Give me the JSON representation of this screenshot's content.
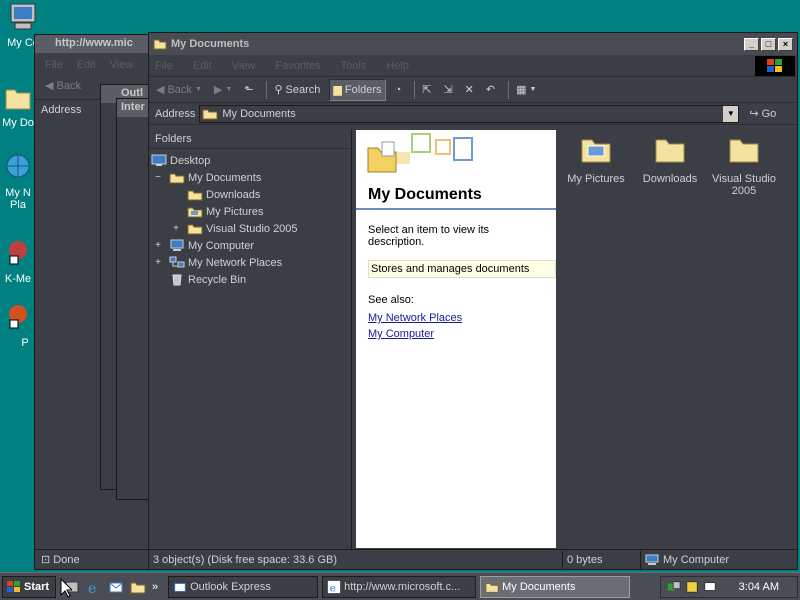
{
  "desktop": {
    "icons": [
      {
        "label": "My Co"
      },
      {
        "label": "My Do"
      },
      {
        "label": "My N Pla"
      },
      {
        "label": "K-Me"
      },
      {
        "label": "P"
      }
    ]
  },
  "bg_windows": {
    "ie_title": "http://www.mic",
    "ie_menu": [
      "File",
      "Edit",
      "View"
    ],
    "ie_back": "Back",
    "ie_address": "Address",
    "ie_status": "Done",
    "outlook_title": "Outl",
    "inter_title": "Inter"
  },
  "window": {
    "title": "My Documents",
    "menu": [
      "File",
      "Edit",
      "View",
      "Favorites",
      "Tools",
      "Help"
    ],
    "toolbar": {
      "back": "Back",
      "search": "Search",
      "folders": "Folders"
    },
    "address_label": "Address",
    "address_value": "My Documents",
    "go_label": "Go"
  },
  "folders_pane": {
    "header": "Folders",
    "items": [
      {
        "label": "Desktop",
        "expander": "",
        "indent": 0
      },
      {
        "label": "My Documents",
        "expander": "−",
        "indent": 1
      },
      {
        "label": "Downloads",
        "expander": "",
        "indent": 2
      },
      {
        "label": "My Pictures",
        "expander": "",
        "indent": 2
      },
      {
        "label": "Visual Studio 2005",
        "expander": "+",
        "indent": 2
      },
      {
        "label": "My Computer",
        "expander": "+",
        "indent": 1
      },
      {
        "label": "My Network Places",
        "expander": "+",
        "indent": 1
      },
      {
        "label": "Recycle Bin",
        "expander": "",
        "indent": 1
      }
    ]
  },
  "webview": {
    "title": "My Documents",
    "prompt": "Select an item to view its description.",
    "description": "Stores and manages documents",
    "see_also": "See also:",
    "links": [
      "My Network Places",
      "My Computer"
    ]
  },
  "files": [
    {
      "label": "My Pictures"
    },
    {
      "label": "Downloads"
    },
    {
      "label": "Visual Studio 2005"
    }
  ],
  "status": {
    "objects": "3 object(s) (Disk free space: 33.6 GB)",
    "size": "0 bytes",
    "zone": "My Computer"
  },
  "taskbar": {
    "start": "Start",
    "tasks": [
      {
        "label": "Outlook Express",
        "active": false
      },
      {
        "label": "http://www.microsoft.c...",
        "active": false
      },
      {
        "label": "My Documents",
        "active": true
      }
    ],
    "more": "»",
    "clock": "3:04 AM"
  },
  "colors": {
    "desktop": "#008080",
    "window_bg": "#3b3f45",
    "folder": "#f4e3a0"
  }
}
